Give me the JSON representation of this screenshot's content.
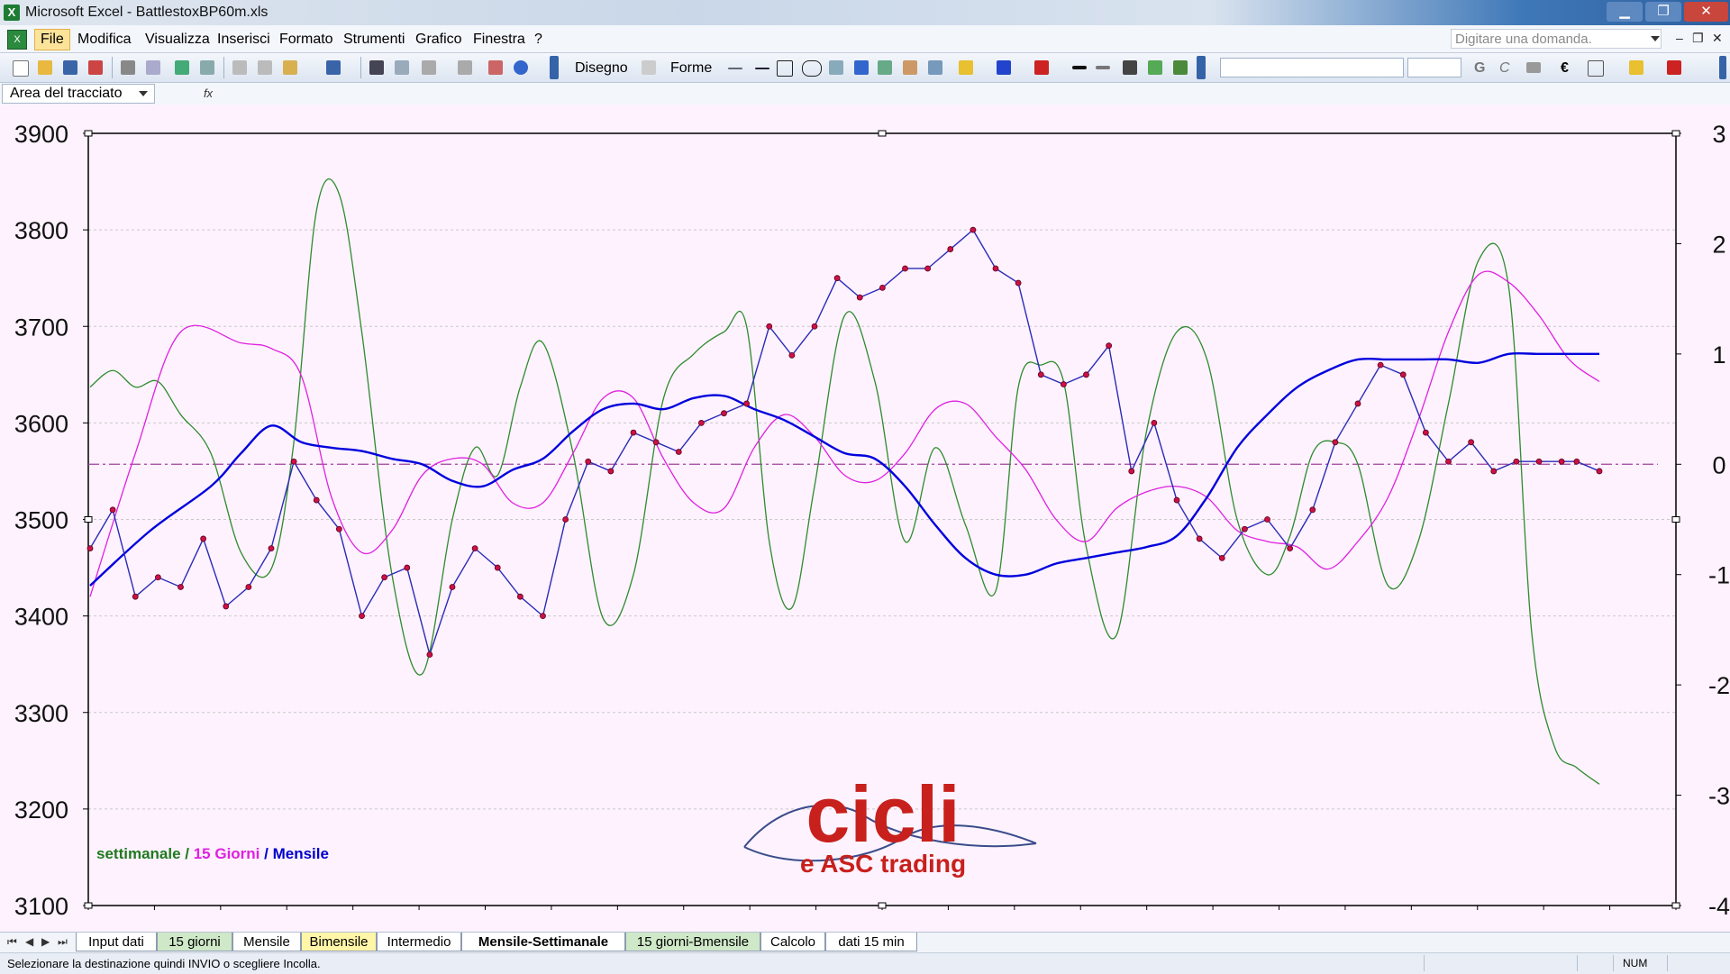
{
  "window": {
    "title": "Microsoft Excel - BattlestoxBP60m.xls",
    "icon": "excel-icon",
    "controls": {
      "minimize": "▁",
      "maximize": "❐",
      "close": "✕"
    }
  },
  "menu": {
    "items": [
      "File",
      "Modifica",
      "Visualizza",
      "Inserisci",
      "Formato",
      "Strumenti",
      "Grafico",
      "Finestra",
      "?"
    ],
    "help_placeholder": "Digitare una domanda.",
    "mdi": [
      "–",
      "❐",
      "✕"
    ]
  },
  "toolbar": {
    "draw_label": "Disegno",
    "shapes_label": "Forme",
    "bold_label": "G",
    "italic_label": "C",
    "euro_label": "€"
  },
  "namebox": {
    "value": "Area del tracciato",
    "fx": "fx"
  },
  "chart_data": {
    "type": "line",
    "left_axis": {
      "min": 3100,
      "max": 3900,
      "step": 100,
      "ticks": [
        3900,
        3800,
        3700,
        3600,
        3500,
        3400,
        3300,
        3200,
        3100
      ]
    },
    "right_axis": {
      "min": -4,
      "max": 3,
      "step": 1,
      "ticks": [
        3,
        2,
        1,
        0,
        -1,
        -2,
        -3,
        -4
      ]
    },
    "gridlines": true,
    "zero_reference": 0,
    "legend": {
      "placement": "bottom-left",
      "parts": [
        {
          "text": "settimanale",
          "color": "#1f7a1f"
        },
        {
          "text": " / ",
          "color": "#1f7a1f"
        },
        {
          "text": "15 Giorni",
          "color": "#e020e0"
        },
        {
          "text": " / ",
          "color": "#0000cc"
        },
        {
          "text": "Mensile",
          "color": "#0000cc"
        }
      ]
    },
    "watermark": {
      "line1": "cicli",
      "line2": "e ASC trading",
      "color": "#c8201c"
    },
    "series": [
      {
        "name": "settimanale",
        "axis": "right",
        "color": "#2e8b2e",
        "t": [
          0,
          1.5,
          3,
          4.5,
          6,
          8,
          10,
          12,
          13.5,
          15,
          16.5,
          18,
          20,
          22,
          24,
          25.5,
          27,
          28.5,
          30,
          32,
          34,
          36,
          38,
          40,
          42,
          43.5,
          45,
          46.5,
          48,
          50,
          52,
          54,
          56,
          58,
          60,
          61.5,
          63,
          64.5,
          66,
          68,
          70,
          72,
          74,
          76,
          78,
          79.5,
          81,
          82.5,
          84,
          86,
          88,
          90,
          92,
          94,
          95.5,
          97,
          98.5,
          100
        ],
        "v": [
          0.7,
          0.85,
          0.7,
          0.75,
          0.45,
          0.1,
          -0.8,
          -0.95,
          0.2,
          2.3,
          2.45,
          1.2,
          -1.0,
          -1.9,
          -0.5,
          0.15,
          -0.1,
          0.7,
          1.1,
          0.1,
          -1.4,
          -1.0,
          0.6,
          1.0,
          1.2,
          1.25,
          -0.7,
          -1.3,
          -0.2,
          1.35,
          0.75,
          -0.7,
          0.15,
          -0.55,
          -1.15,
          0.7,
          0.9,
          0.75,
          -0.75,
          -1.55,
          0.3,
          1.2,
          0.95,
          -0.5,
          -1.0,
          -0.65,
          0.1,
          0.2,
          0.0,
          -1.1,
          -0.7,
          0.55,
          1.85,
          1.6,
          -1.5,
          -2.55,
          -2.75,
          -2.9
        ]
      },
      {
        "name": "15 Giorni",
        "axis": "right",
        "color": "#e020e0",
        "t": [
          0,
          3,
          6,
          10,
          12,
          14,
          16,
          18,
          20,
          22,
          24,
          26,
          28,
          30,
          32,
          34,
          36,
          38,
          40,
          42,
          44,
          46,
          48,
          50,
          52,
          54,
          56,
          58,
          60,
          62,
          64,
          66,
          68,
          70,
          72,
          74,
          76,
          78,
          80,
          82,
          84,
          86,
          88,
          90,
          92,
          94,
          96,
          98,
          100
        ],
        "v": [
          -1.2,
          0.1,
          1.2,
          1.1,
          1.05,
          0.8,
          -0.3,
          -0.8,
          -0.6,
          -0.1,
          0.05,
          0.0,
          -0.35,
          -0.35,
          0.1,
          0.6,
          0.6,
          0.05,
          -0.35,
          -0.4,
          0.15,
          0.45,
          0.25,
          -0.1,
          -0.15,
          0.1,
          0.5,
          0.55,
          0.25,
          -0.05,
          -0.5,
          -0.7,
          -0.4,
          -0.25,
          -0.2,
          -0.3,
          -0.6,
          -0.7,
          -0.75,
          -0.95,
          -0.7,
          -0.3,
          0.4,
          1.2,
          1.72,
          1.65,
          1.35,
          0.95,
          0.75
        ]
      },
      {
        "name": "Mensile",
        "axis": "right",
        "color": "#0000dd",
        "t": [
          0,
          4,
          8,
          10,
          12,
          14,
          16,
          18,
          20,
          22,
          24,
          26,
          28,
          30,
          32,
          34,
          36,
          38,
          40,
          42,
          44,
          46,
          48,
          50,
          52,
          54,
          56,
          58,
          60,
          62,
          64,
          66,
          68,
          70,
          72,
          74,
          76,
          78,
          80,
          82,
          84,
          86,
          88,
          90,
          92,
          94,
          96,
          98,
          100
        ],
        "v": [
          -1.1,
          -0.6,
          -0.2,
          0.1,
          0.35,
          0.2,
          0.15,
          0.12,
          0.05,
          0.0,
          -0.15,
          -0.2,
          -0.05,
          0.05,
          0.3,
          0.5,
          0.55,
          0.5,
          0.6,
          0.62,
          0.5,
          0.4,
          0.25,
          0.1,
          0.05,
          -0.2,
          -0.55,
          -0.85,
          -1.0,
          -1.0,
          -0.9,
          -0.85,
          -0.8,
          -0.75,
          -0.65,
          -0.3,
          0.15,
          0.45,
          0.7,
          0.85,
          0.95,
          0.95,
          0.95,
          0.95,
          0.92,
          1.0,
          1.0,
          1.0,
          1.0
        ]
      },
      {
        "name": "prezzo",
        "axis": "left",
        "color": "#2b2bb8",
        "marker_color": "#cc1144",
        "t": [
          0,
          1.5,
          3,
          4.5,
          6,
          7.5,
          9,
          10.5,
          12,
          13.5,
          15,
          16.5,
          18,
          19.5,
          21,
          22.5,
          24,
          25.5,
          27,
          28.5,
          30,
          31.5,
          33,
          34.5,
          36,
          37.5,
          39,
          40.5,
          42,
          43.5,
          45,
          46.5,
          48,
          49.5,
          51,
          52.5,
          54,
          55.5,
          57,
          58.5,
          60,
          61.5,
          63,
          64.5,
          66,
          67.5,
          69,
          70.5,
          72,
          73.5,
          75,
          76.5,
          78,
          79.5,
          81,
          82.5,
          84,
          85.5,
          87,
          88.5,
          90,
          91.5,
          93,
          94.5,
          96,
          97.5,
          98.5,
          100
        ],
        "v": [
          3470,
          3510,
          3420,
          3440,
          3430,
          3480,
          3410,
          3430,
          3470,
          3560,
          3520,
          3490,
          3400,
          3440,
          3450,
          3360,
          3430,
          3470,
          3450,
          3420,
          3400,
          3500,
          3560,
          3550,
          3590,
          3580,
          3570,
          3600,
          3610,
          3620,
          3700,
          3670,
          3700,
          3750,
          3730,
          3740,
          3760,
          3760,
          3780,
          3800,
          3760,
          3745,
          3650,
          3640,
          3650,
          3680,
          3550,
          3600,
          3520,
          3480,
          3460,
          3490,
          3500,
          3470,
          3510,
          3580,
          3620,
          3660,
          3650,
          3590,
          3560,
          3580,
          3550,
          3560,
          3560,
          3560,
          3560,
          3550
        ]
      }
    ]
  },
  "sheet_tabs": [
    {
      "label": "Input dati",
      "style": "plain"
    },
    {
      "label": "15 giorni",
      "style": "green"
    },
    {
      "label": "Mensile",
      "style": "plain"
    },
    {
      "label": "Bimensile",
      "style": "yellow"
    },
    {
      "label": "Intermedio",
      "style": "plain"
    },
    {
      "label": "Mensile-Settimanale",
      "style": "active"
    },
    {
      "label": "15 giorni-Bmensile",
      "style": "green"
    },
    {
      "label": "Calcolo",
      "style": "plain"
    },
    {
      "label": "dati 15 min",
      "style": "plain"
    }
  ],
  "status": {
    "message": "Selezionare la destinazione quindi INVIO o scegliere Incolla.",
    "num": "NUM"
  }
}
